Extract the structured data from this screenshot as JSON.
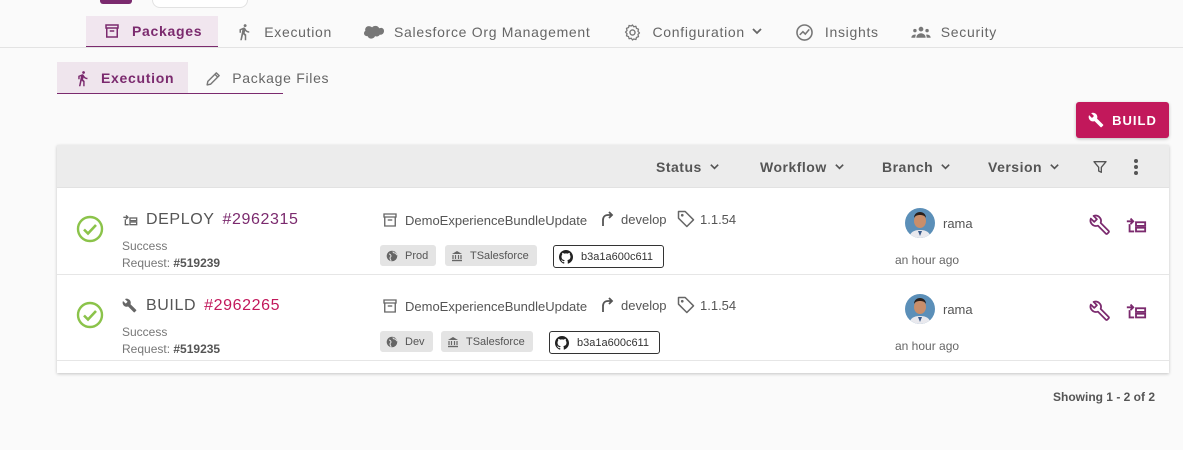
{
  "colors": {
    "accent": "#7b2a6e",
    "build_button": "#c2185b",
    "success": "#8bc34a"
  },
  "nav": {
    "items": [
      {
        "label": "Packages",
        "icon": "archive-icon",
        "active": true
      },
      {
        "label": "Execution",
        "icon": "run-icon"
      },
      {
        "label": "Salesforce Org Management",
        "icon": "cloud-icon"
      },
      {
        "label": "Configuration",
        "icon": "gear-icon"
      },
      {
        "label": "Insights",
        "icon": "insights-icon"
      },
      {
        "label": "Security",
        "icon": "people-icon"
      }
    ]
  },
  "subtabs": [
    {
      "label": "Execution",
      "icon": "run-icon",
      "active": true
    },
    {
      "label": "Package Files",
      "icon": "pencil-icon"
    }
  ],
  "build_button": {
    "label": "BUILD",
    "icon": "wrench-icon"
  },
  "table": {
    "filters": [
      "Status",
      "Workflow",
      "Branch",
      "Version"
    ],
    "rows": [
      {
        "kind": "DEPLOY",
        "kind_icon": "deploy-icon",
        "number": "#2962315",
        "status": "Success",
        "request_label": "Request:",
        "request": "#519239",
        "bundle": "DemoExperienceBundleUpdate",
        "branch": "develop",
        "version": "1.1.54",
        "env": "Prod",
        "org": "TSalesforce",
        "commit": "b3a1a600c611",
        "user": "rama",
        "time": "an hour ago"
      },
      {
        "kind": "BUILD",
        "kind_icon": "wrench-icon",
        "number": "#2962265",
        "status": "Success",
        "request_label": "Request:",
        "request": "#519235",
        "bundle": "DemoExperienceBundleUpdate",
        "branch": "develop",
        "version": "1.1.54",
        "env": "Dev",
        "org": "TSalesforce",
        "commit": "b3a1a600c611",
        "user": "rama",
        "time": "an hour ago"
      }
    ]
  },
  "pagination": {
    "showing": "Showing 1 - 2 of 2"
  }
}
